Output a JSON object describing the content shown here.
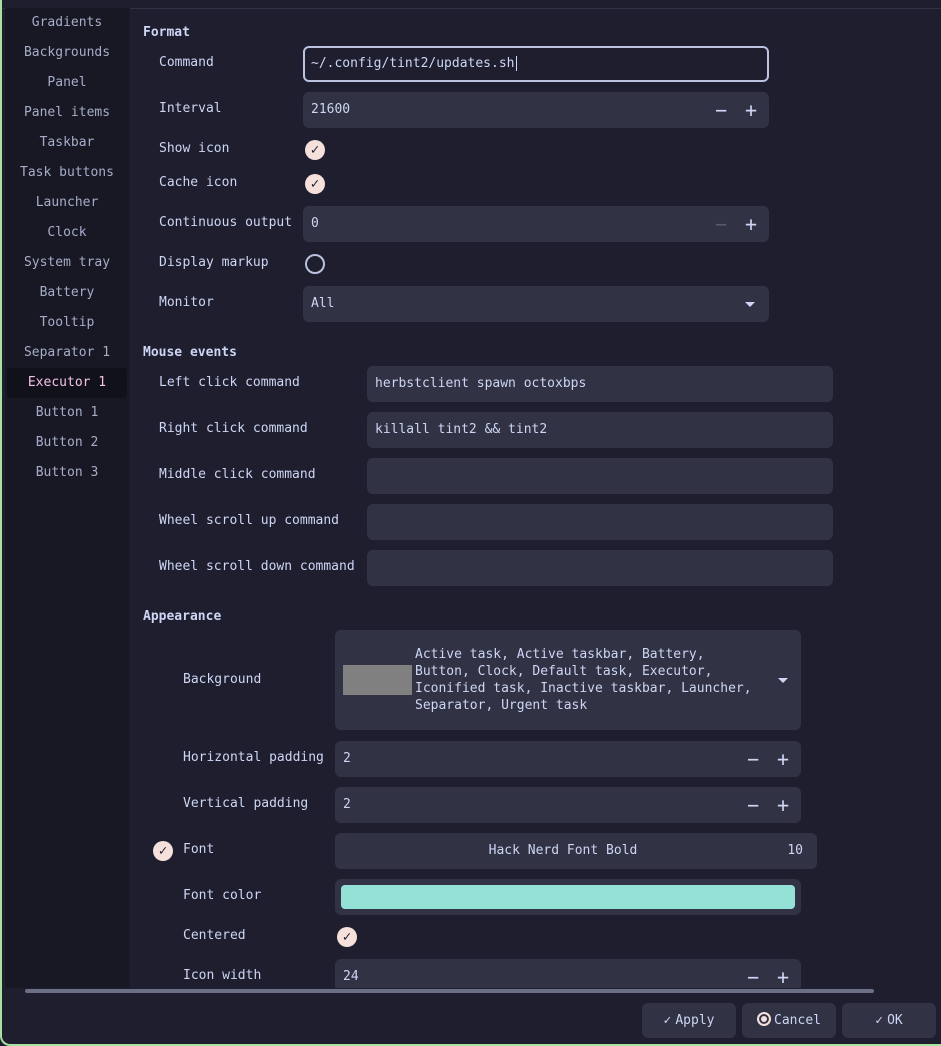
{
  "sidebar": {
    "items": [
      {
        "label": "Gradients"
      },
      {
        "label": "Backgrounds"
      },
      {
        "label": "Panel"
      },
      {
        "label": "Panel items"
      },
      {
        "label": "Taskbar"
      },
      {
        "label": "Task buttons"
      },
      {
        "label": "Launcher"
      },
      {
        "label": "Clock"
      },
      {
        "label": "System tray"
      },
      {
        "label": "Battery"
      },
      {
        "label": "Tooltip"
      },
      {
        "label": "Separator 1"
      },
      {
        "label": "Executor 1"
      },
      {
        "label": "Button 1"
      },
      {
        "label": "Button 2"
      },
      {
        "label": "Button 3"
      }
    ],
    "active": "Executor 1"
  },
  "format": {
    "title": "Format",
    "command_label": "Command",
    "command_value": "~/.config/tint2/updates.sh",
    "interval_label": "Interval",
    "interval_value": "21600",
    "show_icon_label": "Show icon",
    "show_icon_checked": true,
    "cache_icon_label": "Cache icon",
    "cache_icon_checked": true,
    "continuous_label": "Continuous output",
    "continuous_value": "0",
    "markup_label": "Display markup",
    "markup_checked": false,
    "monitor_label": "Monitor",
    "monitor_value": "All"
  },
  "mouse": {
    "title": "Mouse events",
    "left_label": "Left click command",
    "left_value": "herbstclient spawn octoxbps",
    "right_label": "Right click command",
    "right_value": "killall tint2 && tint2",
    "middle_label": "Middle click command",
    "middle_value": "",
    "wheel_up_label": "Wheel scroll up command",
    "wheel_up_value": "",
    "wheel_down_label": "Wheel scroll down command",
    "wheel_down_value": ""
  },
  "appearance": {
    "title": "Appearance",
    "background_label": "Background",
    "background_lines": [
      "Active task, Active taskbar, Battery,",
      "Button, Clock, Default task, Executor,",
      "Iconified task, Inactive taskbar, Launcher,",
      "Separator, Urgent task"
    ],
    "background_color": "#808080",
    "hpad_label": "Horizontal padding",
    "hpad_value": "2",
    "vpad_label": "Vertical padding",
    "vpad_value": "2",
    "font_label": "Font",
    "font_enabled": true,
    "font_name": "Hack Nerd Font Bold",
    "font_size": "10",
    "font_color_label": "Font color",
    "font_color": "#94e2d5",
    "centered_label": "Centered",
    "centered_checked": true,
    "icon_width_label": "Icon width",
    "icon_width_value": "24"
  },
  "buttons": {
    "apply": "Apply",
    "cancel": "Cancel",
    "ok": "OK"
  }
}
